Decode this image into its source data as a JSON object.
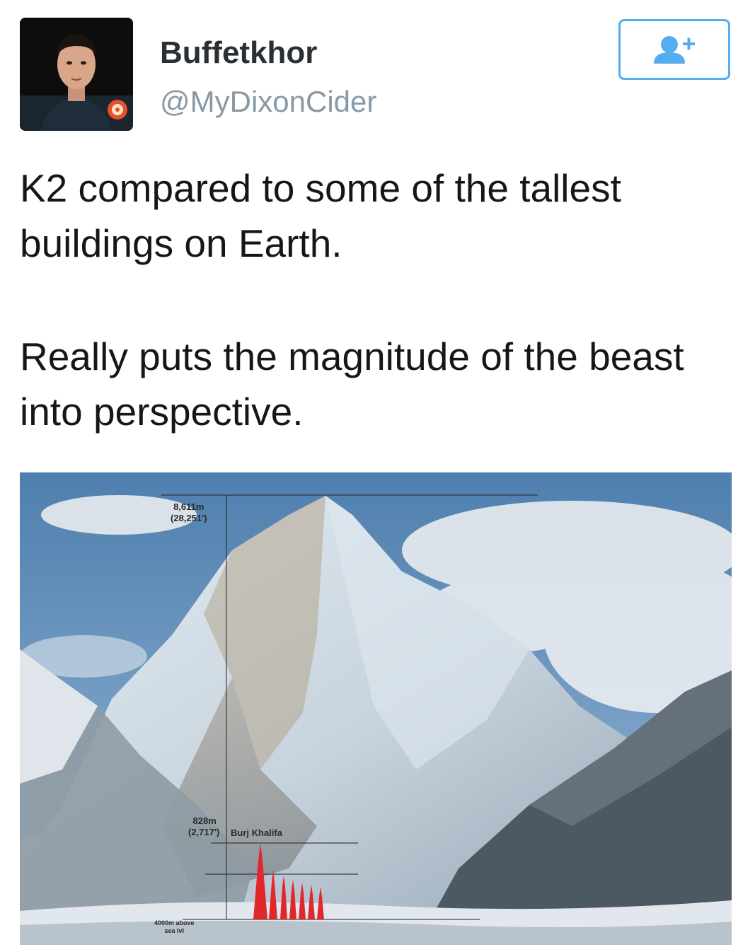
{
  "user": {
    "display_name": "Buffetkhor",
    "handle": "@MyDixonCider"
  },
  "follow_button": {
    "icon": "add-user-icon"
  },
  "tweet": {
    "text_1": "K2 compared to some of the tallest buildings on Earth.",
    "text_2": "Really puts the magnitude of the beast into perspective."
  },
  "image": {
    "k2_height_m": "8,611m",
    "k2_height_ft": "(28,251')",
    "burj_height_m": "828m",
    "burj_height_ft": "(2,717')",
    "burj_label": "Burj Khalifa",
    "base_label_1": "4000m above",
    "base_label_2": "sea lvl"
  },
  "colors": {
    "accent": "#55acee",
    "name": "#292f33",
    "handle": "#8899a6",
    "building_red": "#e0282c"
  }
}
